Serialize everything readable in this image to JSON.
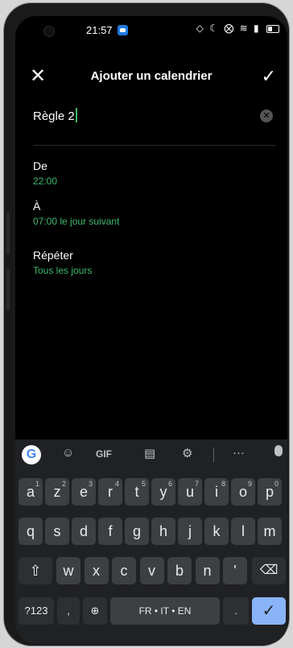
{
  "status": {
    "time": "21:57",
    "icons": "◇ ☾ ⨂ ≋ ▮"
  },
  "header": {
    "close": "✕",
    "title": "Ajouter un calendrier",
    "confirm": "✓"
  },
  "form": {
    "name": "Règle 2",
    "clear": "✕",
    "from_label": "De",
    "from_value": "22:00",
    "to_label": "À",
    "to_value": "07:00 le jour suivant",
    "repeat_label": "Répéter",
    "repeat_value": "Tous les jours"
  },
  "keyboard": {
    "suggest": {
      "gif": "GIF",
      "more": "···"
    },
    "row1": [
      {
        "k": "a",
        "h": "1"
      },
      {
        "k": "z",
        "h": "2"
      },
      {
        "k": "e",
        "h": "3"
      },
      {
        "k": "r",
        "h": "4"
      },
      {
        "k": "t",
        "h": "5"
      },
      {
        "k": "y",
        "h": "6"
      },
      {
        "k": "u",
        "h": "7"
      },
      {
        "k": "i",
        "h": "8"
      },
      {
        "k": "o",
        "h": "9"
      },
      {
        "k": "p",
        "h": "0"
      }
    ],
    "row2": [
      "q",
      "s",
      "d",
      "f",
      "g",
      "h",
      "j",
      "k",
      "l",
      "m"
    ],
    "row3": [
      "w",
      "x",
      "c",
      "v",
      "b",
      "n",
      "'"
    ],
    "shift": "⇧",
    "backspace": "⌫",
    "symbols": "?123",
    "emoji_comma": ",",
    "globe": "⊕",
    "space": "FR • IT • EN",
    "period": ".",
    "enter": "✓"
  }
}
